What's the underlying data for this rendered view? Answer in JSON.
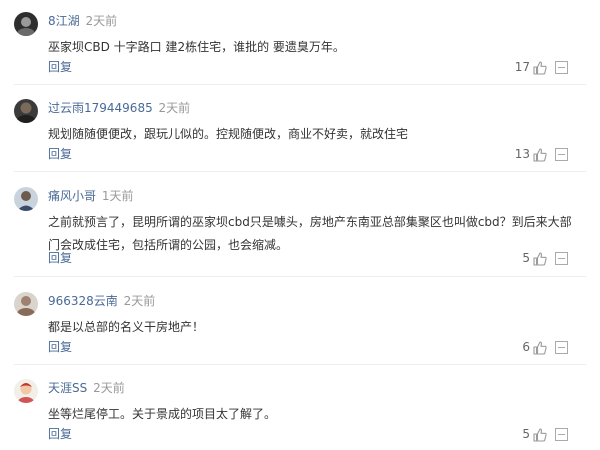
{
  "comments": [
    {
      "user": "8江湖",
      "time": "2天前",
      "content": "巫家坝CBD 十字路口 建2栋住宅，谁批的 要遗臭万年。",
      "reply": "回复",
      "likes": "17"
    },
    {
      "user": "过云雨179449685",
      "time": "2天前",
      "content": "规划随随便便改，跟玩儿似的。控规随便改，商业不好卖，就改住宅",
      "reply": "回复",
      "likes": "13"
    },
    {
      "user": "痛风小哥",
      "time": "1天前",
      "content": "之前就预言了，昆明所谓的巫家坝cbd只是噱头，房地产东南亚总部集聚区也叫做cbd？到后来大部门会改成住宅，包括所谓的公园，也会缩减。",
      "reply": "回复",
      "likes": "5"
    },
    {
      "user": "966328云南",
      "time": "2天前",
      "content": "都是以总部的名义干房地产！",
      "reply": "回复",
      "likes": "6"
    },
    {
      "user": "天涯SS",
      "time": "2天前",
      "content": "坐等烂尾停工。关于景成的项目太了解了。",
      "reply": "回复",
      "likes": "5"
    }
  ],
  "icons": {
    "like": "thumbs-up-icon",
    "more": "more-options-icon"
  },
  "colors": {
    "username": "#4a6a96",
    "time": "#999999",
    "text": "#333333",
    "reply": "#4a6a96"
  }
}
